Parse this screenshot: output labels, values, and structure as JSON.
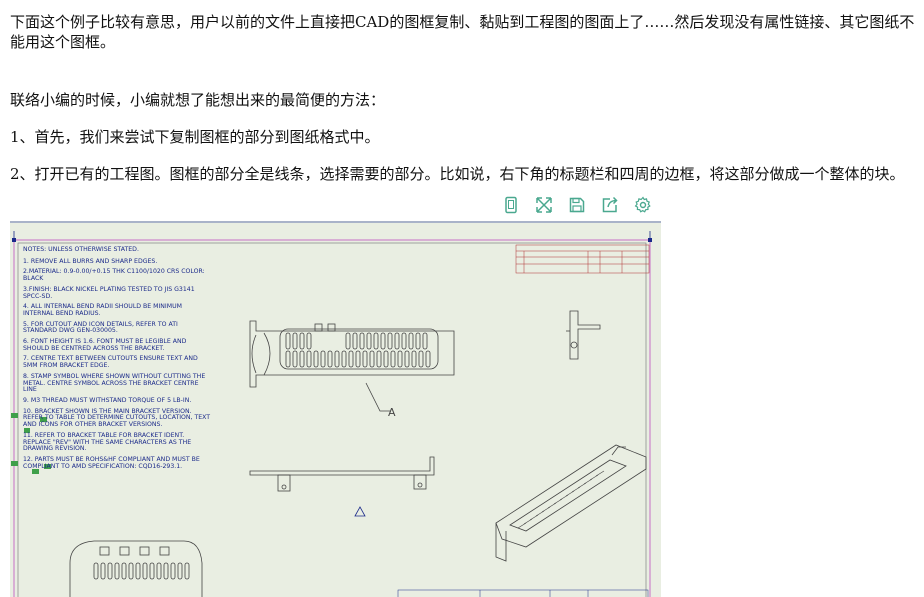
{
  "article": {
    "paragraphs": [
      "下面这个例子比较有意思，用户以前的文件上直接把CAD的图框复制、黏贴到工程图的图面上了……然后发现没有属性链接、其它图纸不能用这个图框。",
      "联络小编的时候，小编就想了能想出来的最简便的方法：",
      "1、首先，我们来尝试下复制图框的部分到图纸格式中。",
      "2、打开已有的工程图。图框的部分全是线条，选择需要的部分。比如说，右下角的标题栏和四周的边框，将这部分做成一个整体的块。"
    ]
  },
  "toolbar": {
    "icons": [
      "phone-view-icon",
      "fullscreen-icon",
      "save-icon",
      "share-icon",
      "settings-icon"
    ],
    "icon_color": "#4aa88f"
  },
  "drawing": {
    "notes_header": "NOTES: UNLESS OTHERWISE STATED.",
    "notes": [
      "1. REMOVE ALL BURRS AND SHARP EDGES.",
      "2.MATERIAL: 0.9-0.00/+0.15 THK C1100/1020 CRS COLOR: BLACK",
      "3.FINISH: BLACK NICKEL PLATING TESTED TO JIS G3141 SPCC-SD.",
      "4. ALL INTERNAL BEND RADII SHOULD BE MINIMUM INTERNAL BEND RADIUS.",
      "5. FOR CUTOUT AND ICON DETAILS, REFER TO ATI STANDARD DWG GEN-030005.",
      "6. FONT HEIGHT IS 1.6. FONT MUST BE LEGIBLE AND SHOULD BE CENTRED ACROSS THE BRACKET.",
      "7. CENTRE TEXT BETWEEN CUTOUTS ENSURE TEXT AND 5MM FROM BRACKET EDGE.",
      "8. STAMP SYMBOL WHERE SHOWN WITHOUT CUTTING THE METAL. CENTRE SYMBOL ACROSS THE BRACKET CENTRE LINE",
      "9. M3 THREAD MUST WITHSTAND TORQUE OF 5 LB-IN.",
      "10. BRACKET SHOWN IS THE MAIN BRACKET VERSION. REFER TO TABLE TO DETERMINE CUTOUTS, LOCATION, TEXT AND ICONS FOR OTHER BRACKET VERSIONS.",
      "11. REFER TO BRACKET TABLE FOR BRACKET IDENT. REPLACE \"REV\" WITH THE SAME CHARACTERS AS THE DRAWING REVISION.",
      "12. PARTS MUST BE ROHS&HF COMPLIANT AND MUST BE COMPLIANT TO AMD SPECIFICATION: CQD16-293.1."
    ],
    "view_label": "A",
    "colors": {
      "paper": "#e9eee2",
      "ink": "#1b2a8a",
      "line": "#555555",
      "accent": "#b03030",
      "frame": "#c050c0"
    }
  }
}
